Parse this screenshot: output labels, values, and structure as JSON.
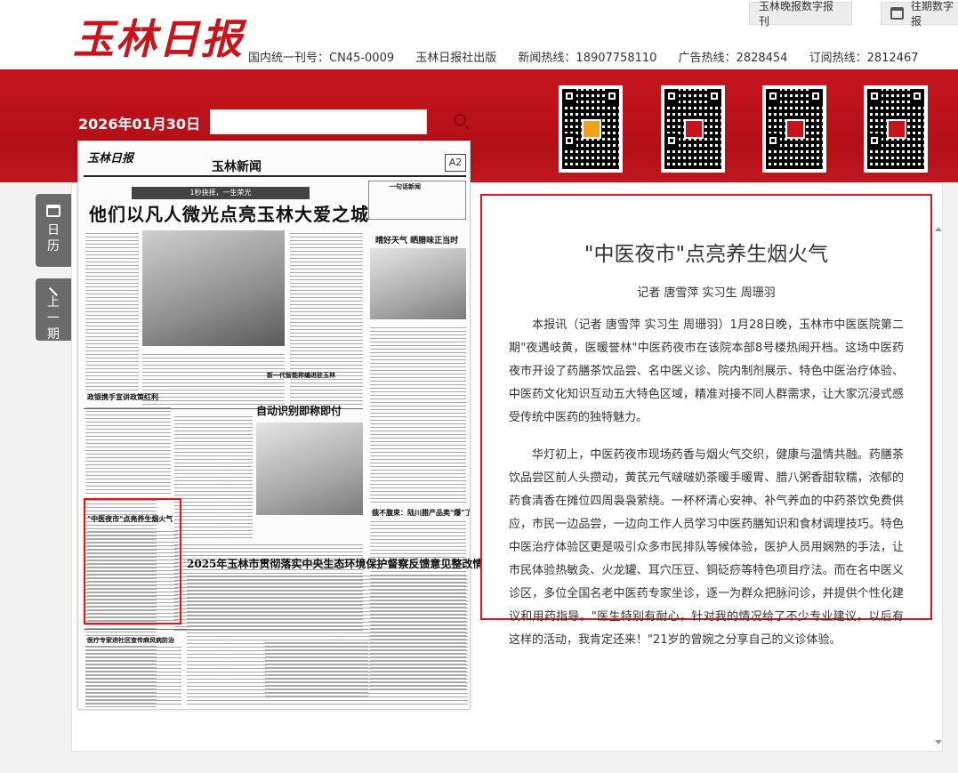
{
  "header": {
    "logo": "玉林日报",
    "buttons": [
      {
        "label": "玉林晚报数字报刊"
      },
      {
        "label": "往期数字报"
      }
    ],
    "info": [
      "国内统一刊号：CN45-0009",
      "玉林日报社出版",
      "新闻热线：18907758110",
      "广告热线：2828454",
      "订阅热线：2812467"
    ]
  },
  "toolbar": {
    "date": "2026年01月30日",
    "search_placeholder": ""
  },
  "qr_codes": [
    {
      "icon": "qr-code-icon"
    },
    {
      "icon": "qr-code-icon"
    },
    {
      "icon": "qr-code-icon"
    },
    {
      "icon": "qr-code-icon"
    }
  ],
  "side_nav": {
    "calendar": {
      "chars": [
        "日",
        "历"
      ]
    },
    "prev": {
      "chars": [
        "上",
        "一",
        "期"
      ]
    }
  },
  "newspaper": {
    "masthead": "玉林日报",
    "section": "玉林新闻",
    "page_no": "A2",
    "kicker": "1秒抉择，一生荣光",
    "headline": "他们以凡人微光点亮玉林大爱之城",
    "side_title": "晴好天气  晒腊味正当时",
    "side_box_title": "一句话新闻",
    "left_title": "政银携手宣讲政策红利",
    "mid_title": "自动识别即称即付",
    "mid_kicker": "新一代智能称编进驻玉林",
    "right_title": "俄不腹束：陆川腊产品卖\"爆\"了",
    "highlight_title": "\"中医夜市\"点亮养生烟火气",
    "big_headline": "2025年玉林市贯彻落实中央生态环境保护督察反馈意见整改情况",
    "bottom_title": "医疗专家进社区宣传麻风病防治"
  },
  "article": {
    "title": "\"中医夜市\"点亮养生烟火气",
    "author": "记者 唐雪萍 实习生 周珊羽",
    "paragraphs": [
      "本报讯（记者 唐雪萍 实习生 周珊羽）1月28日晚，玉林市中医医院第二期\"夜遇岐黄，医暖誉林\"中医药夜市在该院本部8号楼热闹开档。这场中医药夜市开设了药膳茶饮品尝、名中医义诊、院内制剂展示、特色中医治疗体验、中医药文化知识互动五大特色区域，精准对接不同人群需求，让大家沉浸式感受传统中医药的独特魅力。",
      "华灯初上，中医药夜市现场药香与烟火气交织，健康与温情共融。药膳茶饮品尝区前人头攒动，黄芪元气啵啵奶茶暖手暖胃、腊八粥香甜软糯，浓郁的药食清香在摊位四周袅袅萦绕。一杯杯清心安神、补气养血的中药茶饮免费供应，市民一边品尝，一边向工作人员学习中医药膳知识和食材调理技巧。特色中医治疗体验区更是吸引众多市民排队等候体验，医护人员用娴熟的手法，让市民体验热敏灸、火龙罐、耳穴压豆、铜砭痧等特色项目疗法。而在名中医义诊区，多位全国名老中医药专家坐诊，逐一为群众把脉问诊，并提供个性化建议和用药指导。\"医生特别有耐心，针对我的情况给了不少专业建议，以后有这样的活动，我肯定还来！\"21岁的曾婉之分享自己的义诊体验。"
    ]
  },
  "colors": {
    "brand_red": "#c8141c",
    "highlight_red": "#e0141c"
  }
}
